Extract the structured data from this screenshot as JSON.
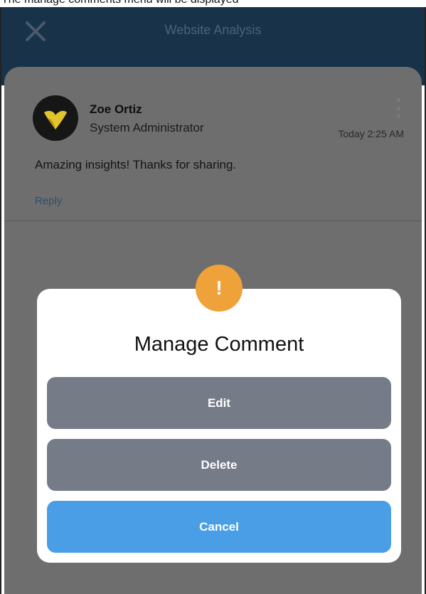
{
  "caption": "The manage comments menu will be displayed",
  "appbar": {
    "title": "Website Analysis",
    "close_icon": "close-icon"
  },
  "comment": {
    "author": "Zoe Ortiz",
    "role": "System Administrator",
    "timestamp": "Today 2:25 AM",
    "text": "Amazing insights! Thanks for sharing.",
    "reply_label": "Reply"
  },
  "modal": {
    "badge_symbol": "!",
    "title": "Manage Comment",
    "edit_label": "Edit",
    "delete_label": "Delete",
    "cancel_label": "Cancel"
  },
  "colors": {
    "appbar": "#18324a",
    "overlay": "#6e6e6e",
    "alert": "#f0a23a",
    "neutral_button": "#767b88",
    "cancel_button": "#4a9ee6"
  }
}
